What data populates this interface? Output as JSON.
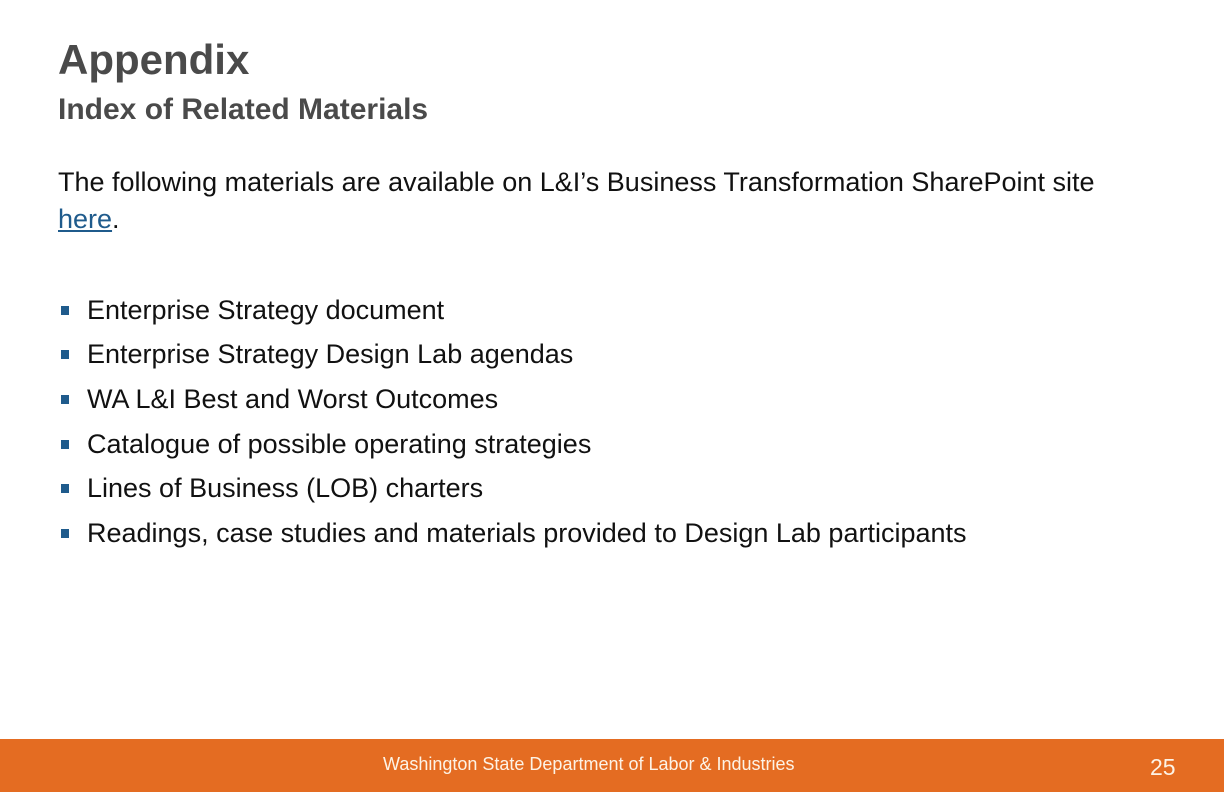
{
  "slide": {
    "title": "Appendix",
    "subtitle": "Index of Related Materials",
    "intro": {
      "text_before": "The following materials are available on L&I’s Business Transformation SharePoint site ",
      "link_text": "here",
      "text_after": "."
    },
    "bullets": [
      "Enterprise Strategy document",
      "Enterprise Strategy Design Lab agendas",
      "WA L&I Best and Worst Outcomes",
      "Catalogue of possible operating strategies",
      "Lines of Business (LOB) charters",
      "Readings, case studies and materials provided to Design Lab participants"
    ],
    "bullet_icon": "square-bullet-icon"
  },
  "footer": {
    "organization": "Washington State Department of Labor & Industries",
    "page_number": "25"
  },
  "colors": {
    "title": "#4a4a4a",
    "body_text": "#111111",
    "link": "#1f5b8c",
    "bullet": "#1f5b8c",
    "footer_bg": "#e46c22",
    "footer_text": "#fdf3e6"
  }
}
